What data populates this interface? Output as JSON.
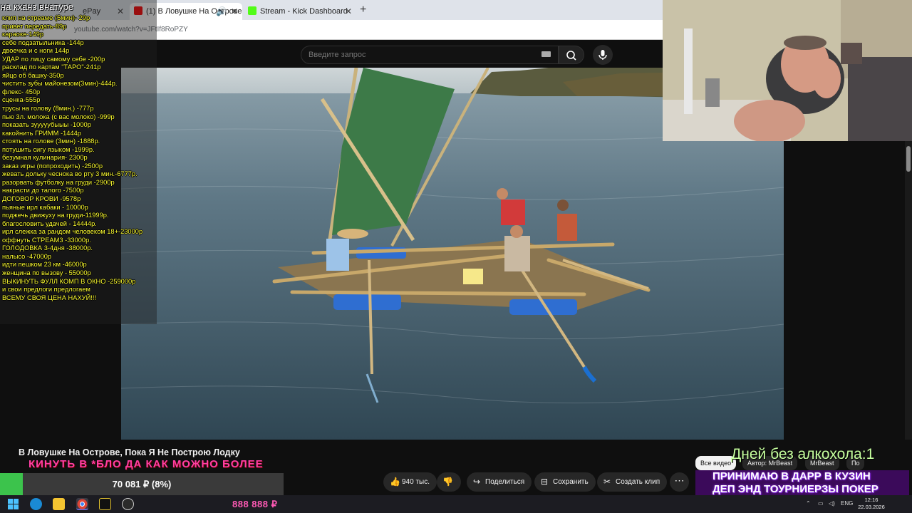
{
  "browser": {
    "tabs": [
      {
        "label": "ePay",
        "active": false
      },
      {
        "label": "(1) В Ловушке На Острове",
        "active": true
      },
      {
        "label": "Stream - Kick Dashboard",
        "active": false
      }
    ],
    "url": "youtube.com/watch?v=JFtIf8RoPZY"
  },
  "youtube": {
    "search_placeholder": "Введите запрос",
    "video_title": "В Ловушке На Острове, Пока Я Не Построю Лодку",
    "actions": {
      "likes": "940 тыс.",
      "share": "Поделиться",
      "save": "Сохранить",
      "clip": "Создать клип"
    },
    "chips": {
      "all_videos": "Все видео",
      "author": "Автор: MrBeast",
      "channel": "MrBeast",
      "more": "По"
    }
  },
  "overlay": {
    "title": "на кханз внатуре",
    "price_list": [
      "клип на стреаме (5мин)- 29р",
      "привет передать-89р",
      "караоке-149р",
      "себе подзатыльника -144р",
      "двоечка и с ноги 144р",
      "УДАР по лицу самому себе -200р",
      "расклад по картам \"ТАРО\"-241р",
      "яйцо об башку-350р",
      "чистить зубы майонезом(3мин)-444р.",
      "флекс- 450р",
      "сценка-555р",
      "трусы на голову (8мин.) -777р",
      "пью 3л. молока (с вас молоко) -999р",
      "показать зууууубыыы -1000р",
      "какойнить ГРИММ -1444р",
      "стоять на голове (3мин) -1888р.",
      "потушить сигу языком -1999р.",
      "безумная кулинария- 2300р",
      "заказ игры (попроходить) -2500р",
      "жевать дольку чеснока во рту 3 мин.-6777р.",
      "разорвать футболку на груди -2900р",
      "накрасти до талого -7500р",
      "ДОГОВОР КРОВИ -9578р",
      "пьяные ирл кабаки - 10000р",
      "поджечь движуху на груди-11999р.",
      "благословить удачей - 14444р.",
      "ирл слежка за рандом человеком 18+-23000р",
      "оффнуть СТРЕАМ3 -33000р.",
      "ГОЛОДОВКА 3-4дня -38000р.",
      "налысо -47000р",
      "идти пешком 23 км -46000р",
      "женщина по вызову - 55000р",
      "ВЫКИНУТЬ ФУЛЛ КОМП В ОКНО -259000р",
      "и свои предлоги предлогаем",
      "ВСЕМУ СВОЯ ЦЕНА НАХУЙ!!!"
    ],
    "ticker": "КИНУТЬ В *БЛО ДА КАК МОЖНО БОЛЕЕ",
    "goal": {
      "text": "70 081 ₽ (8%)",
      "progress": 0.08,
      "color": "#3cc34c"
    },
    "days_without_alcohol": "Дней без алкохола:1",
    "promo_line1": "ПРИНИМАЮ В ДАРР В КУЗИН",
    "promo_line2": "ДЕП ЭНД ТОУРНИЕРЗЫ ПОКЕР",
    "money_counter": "888 888 ₽"
  },
  "taskbar": {
    "lang": "ENG",
    "time": "12:16",
    "date": "22.03.2026",
    "icons": [
      "start-icon",
      "edge-icon",
      "explorer-icon",
      "chrome-icon",
      "app-icon",
      "obs-icon"
    ]
  },
  "colors": {
    "accent_yellow": "#ffff33",
    "ticker_pink": "#ff3fa4",
    "goal_green": "#3cc34c",
    "promo_purple": "#3b0a5a"
  }
}
